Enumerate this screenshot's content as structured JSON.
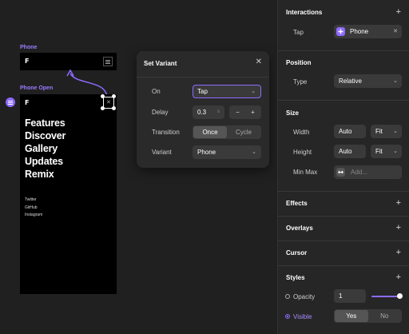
{
  "canvas": {
    "phone_label": "Phone",
    "phone_open_label": "Phone Open",
    "menu_items": [
      "Features",
      "Discover",
      "Gallery",
      "Updates",
      "Remix"
    ],
    "social_links": [
      "Twitter",
      "GitHub",
      "Instagram"
    ],
    "logo_glyph": "F",
    "close_glyph": "✕"
  },
  "modal": {
    "title": "Set Variant",
    "close_glyph": "✕",
    "on_label": "On",
    "on_value": "Tap",
    "delay_label": "Delay",
    "delay_value": "0.3",
    "delay_unit": "s",
    "minus": "−",
    "plus": "+",
    "transition_label": "Transition",
    "transition_options": [
      "Once",
      "Cycle"
    ],
    "transition_selected": "Once",
    "variant_label": "Variant",
    "variant_value": "Phone",
    "chevron": "⌄"
  },
  "panel": {
    "interactions_title": "Interactions",
    "tap_label": "Tap",
    "tap_value": "Phone",
    "position_title": "Position",
    "type_label": "Type",
    "type_value": "Relative",
    "size_title": "Size",
    "width_label": "Width",
    "width_value": "Auto",
    "width_mode": "Fit",
    "height_label": "Height",
    "height_value": "Auto",
    "height_mode": "Fit",
    "minmax_label": "Min Max",
    "minmax_placeholder": "Add...",
    "effects_title": "Effects",
    "overlays_title": "Overlays",
    "cursor_title": "Cursor",
    "styles_title": "Styles",
    "opacity_label": "Opacity",
    "opacity_value": "1",
    "visible_label": "Visible",
    "visible_options": [
      "Yes",
      "No"
    ],
    "visible_selected": "Yes",
    "plus": "+",
    "close_glyph": "✕",
    "chevron": "⌄"
  },
  "colors": {
    "accent": "#8e6bff",
    "canvas_bg": "#202020",
    "panel_bg": "#262626"
  }
}
